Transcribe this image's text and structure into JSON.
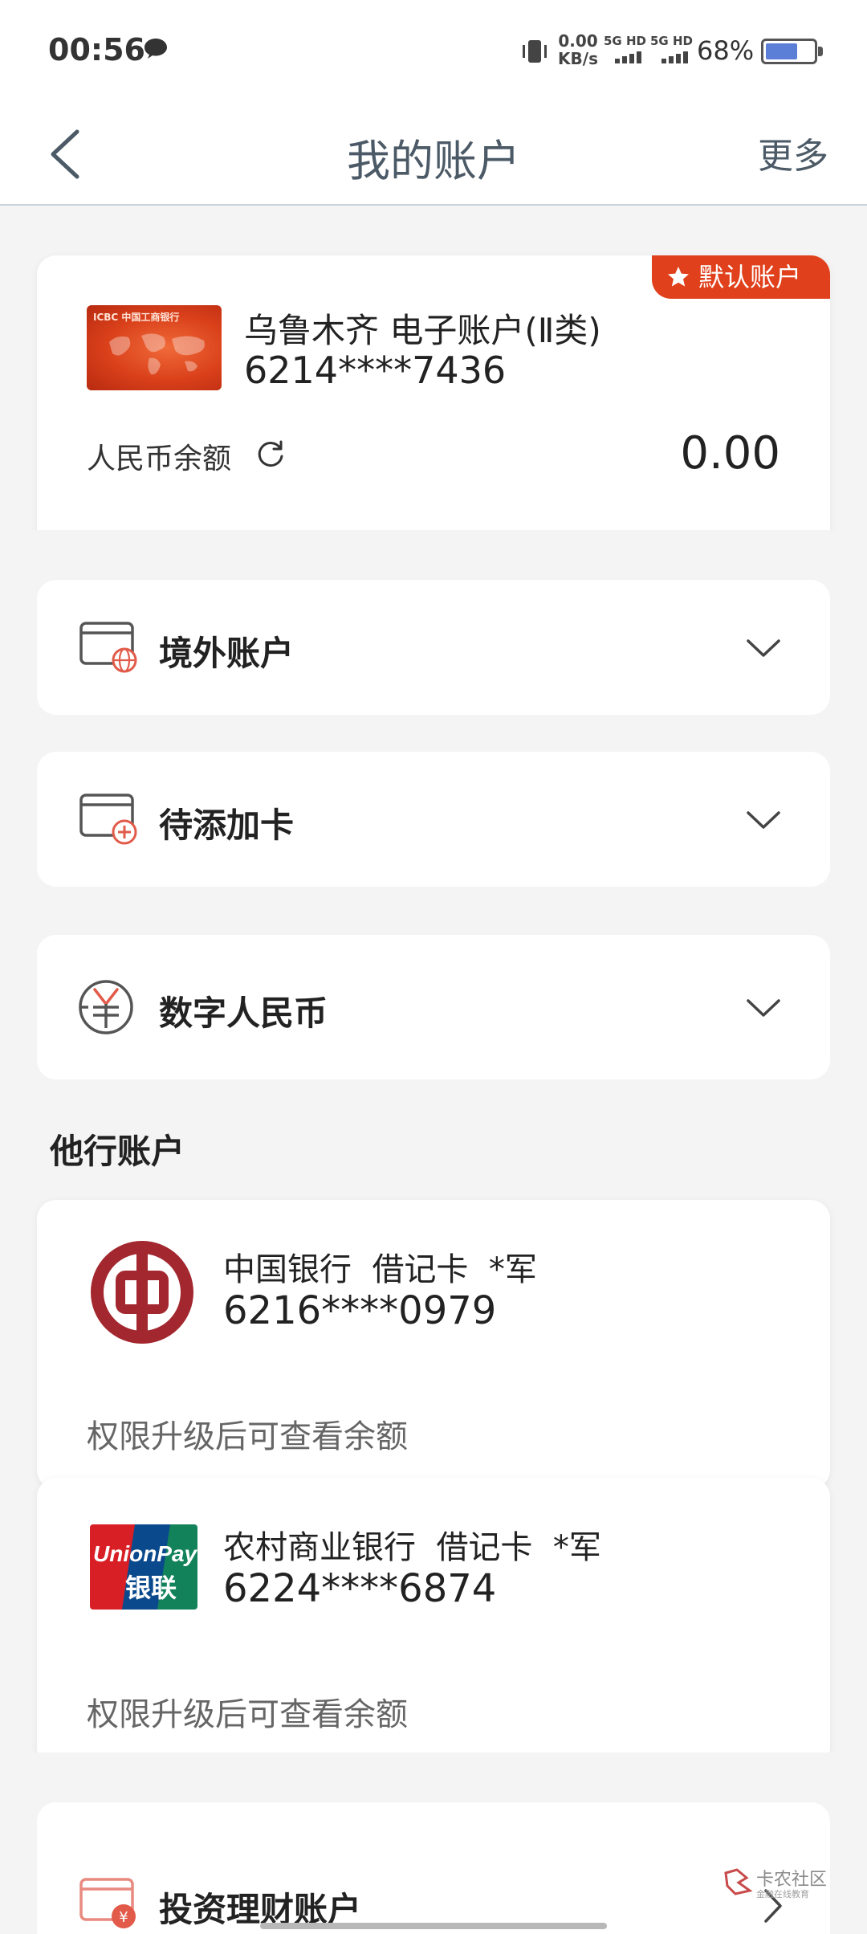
{
  "status_bar": {
    "time": "00:56",
    "net_speed_value": "0.00",
    "net_speed_unit": "KB/s",
    "sim1_label": "5G HD",
    "sim2_label": "5G HD",
    "battery_percent_text": "68%",
    "battery_level": 0.68,
    "icons": [
      "message-icon",
      "vibrate-icon",
      "signal-icon",
      "battery-icon"
    ]
  },
  "header": {
    "title": "我的账户",
    "more_label": "更多",
    "back_icon": "chevron-left-icon"
  },
  "default_account": {
    "tag": "默认账户",
    "name": "乌鲁木齐 电子账户(Ⅱ类)",
    "number": "6214****7436",
    "balance_label": "人民币余额",
    "balance_value": "0.00",
    "card_image_text": "ICBC 中国工商银行",
    "accent": "#e0401b"
  },
  "sections": [
    {
      "label": "境外账户",
      "icon": "card-globe-icon"
    },
    {
      "label": "待添加卡",
      "icon": "card-add-icon"
    },
    {
      "label": "数字人民币",
      "icon": "digital-rmb-icon"
    }
  ],
  "other_accounts": {
    "title": "他行账户",
    "items": [
      {
        "bank": "中国银行",
        "type": "借记卡",
        "holder": "*军",
        "number": "6216****0979",
        "hint": "权限升级后可查看余额",
        "logo": "bank-of-china-logo"
      },
      {
        "bank": "农村商业银行",
        "type": "借记卡",
        "holder": "*军",
        "number": "6224****6874",
        "hint": "权限升级后可查看余额",
        "logo": "unionpay-logo"
      }
    ]
  },
  "unionpay_logo": {
    "top": "UnionPay",
    "bottom": "银联"
  },
  "investment": {
    "label": "投资理财账户",
    "icon": "card-money-icon"
  },
  "watermark": {
    "text": "卡农社区",
    "sub": "金融在线教育"
  }
}
